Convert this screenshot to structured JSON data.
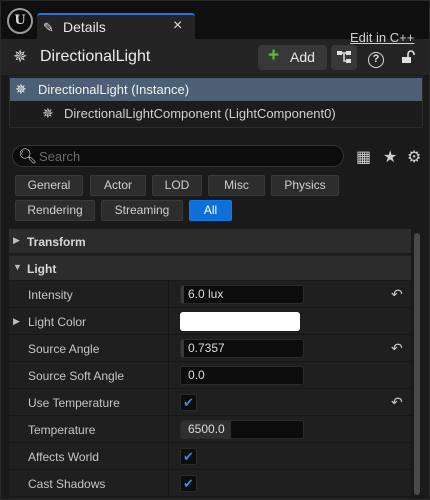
{
  "tab": {
    "title": "Details",
    "close": "×"
  },
  "header": {
    "actor_name": "DirectionalLight",
    "add_label": "Add"
  },
  "tree": {
    "instance_label": "DirectionalLight (Instance)",
    "component_label": "DirectionalLightComponent (LightComponent0)",
    "edit_link": "Edit in C++"
  },
  "search": {
    "placeholder": "Search",
    "value": ""
  },
  "filters": [
    {
      "label": "General",
      "active": false
    },
    {
      "label": "Actor",
      "active": false
    },
    {
      "label": "LOD",
      "active": false
    },
    {
      "label": "Misc",
      "active": false
    },
    {
      "label": "Physics",
      "active": false
    },
    {
      "label": "Rendering",
      "active": false
    },
    {
      "label": "Streaming",
      "active": false
    },
    {
      "label": "All",
      "active": true
    }
  ],
  "categories": {
    "transform": {
      "label": "Transform",
      "expanded": false
    },
    "light": {
      "label": "Light",
      "expanded": true
    }
  },
  "properties": [
    {
      "name": "Intensity",
      "value": "6.0 lux",
      "type": "number",
      "resettable": true
    },
    {
      "name": "Light Color",
      "value": "#ffffff",
      "type": "color",
      "resettable": false
    },
    {
      "name": "Source Angle",
      "value": "0.7357",
      "type": "number",
      "resettable": true
    },
    {
      "name": "Source Soft Angle",
      "value": "0.0",
      "type": "number",
      "resettable": false
    },
    {
      "name": "Use Temperature",
      "value": "true",
      "type": "checkbox",
      "resettable": true
    },
    {
      "name": "Temperature",
      "value": "6500.0",
      "type": "number",
      "resettable": false
    },
    {
      "name": "Affects World",
      "value": "true",
      "type": "checkbox",
      "resettable": false
    },
    {
      "name": "Cast Shadows",
      "value": "true",
      "type": "checkbox",
      "resettable": false
    }
  ],
  "icons": {
    "pencil": "pencil-icon",
    "light": "directional-light-icon",
    "blueprint": "blueprint-icon",
    "help": "help-icon",
    "lock": "lock-icon",
    "search": "search-icon",
    "table": "table-view-icon",
    "favorite": "star-icon",
    "settings": "gear-icon",
    "reset": "reset-to-default-icon"
  },
  "colors": {
    "accent": "#0f6fd8",
    "selection": "#4d5f75",
    "add_plus": "#5fbf3a",
    "checkbox": "#2f8ff0"
  }
}
